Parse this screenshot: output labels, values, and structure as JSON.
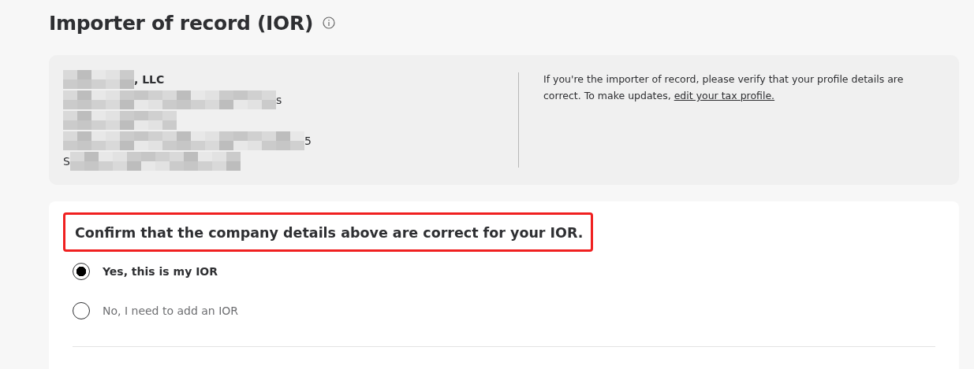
{
  "title": "Importer of record (IOR)",
  "profile": {
    "lines": [
      {
        "kind": "mosaic-then-text",
        "text": ", LLC",
        "bold": true
      },
      {
        "kind": "mosaic-then-text",
        "text": "s",
        "bold": false
      },
      {
        "kind": "mosaic-only"
      },
      {
        "kind": "mosaic-then-text",
        "text": "5",
        "bold": false
      },
      {
        "kind": "text-then-mosaic",
        "text": "S",
        "bold": false
      }
    ],
    "note": "If you're the importer of record, please verify that your profile details are correct. To make updates, ",
    "link": "edit your tax profile."
  },
  "question": {
    "text": "Confirm that the company details above are correct for your IOR.",
    "highlighted": true
  },
  "options": [
    {
      "label": "Yes, this is my IOR",
      "selected": true
    },
    {
      "label": "No, I need to add an IOR",
      "selected": false
    }
  ]
}
